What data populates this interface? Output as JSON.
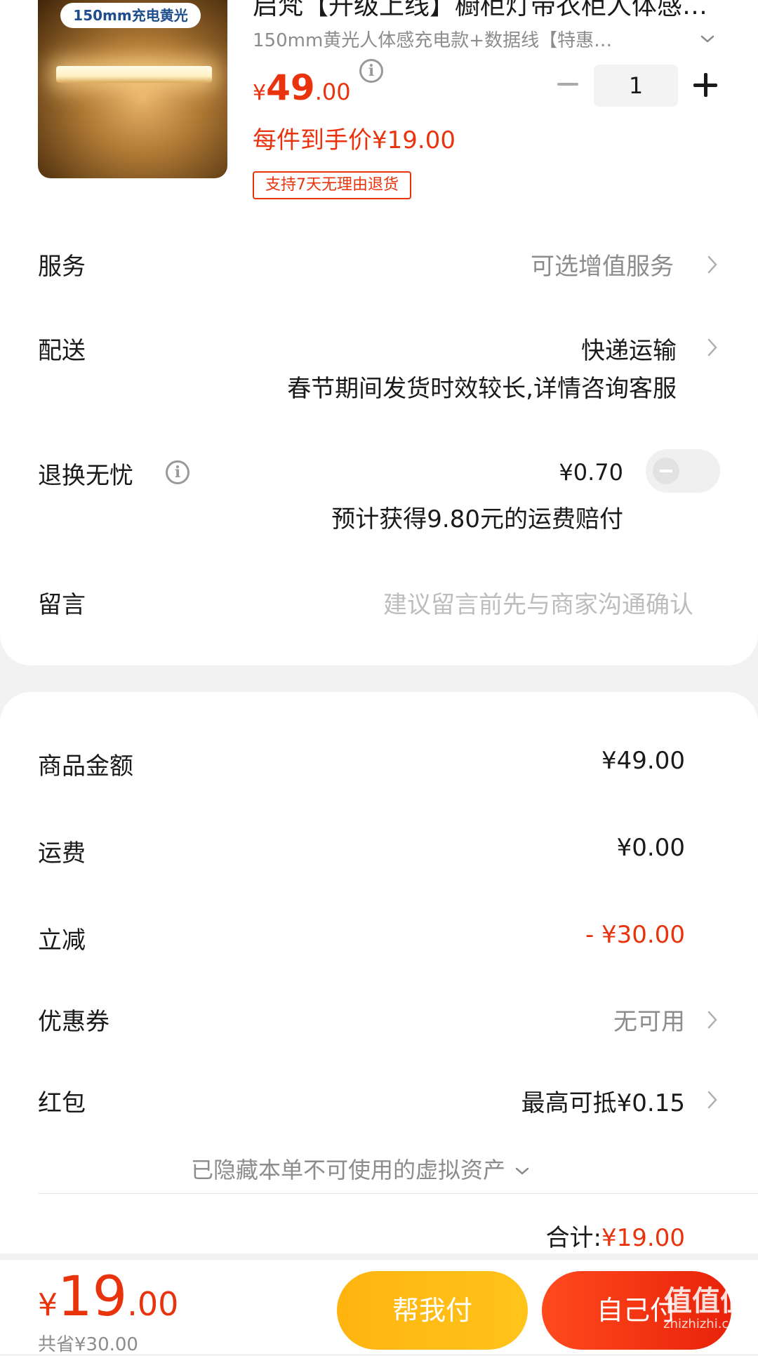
{
  "product": {
    "image_tag": "150mm充电黄光",
    "title": "启梵【升级上线】橱柜灯带衣柜人体感应灯",
    "spec": "150mm黄光人体感充电款+数据线【特惠…",
    "price_currency": "¥",
    "price_integer": "49",
    "price_decimal": ".00",
    "quantity": "1",
    "final_price": "每件到手价¥19.00",
    "return_badge": "支持7天无理由退货"
  },
  "order_options": {
    "service": {
      "label": "服务",
      "value": "可选增值服务"
    },
    "delivery": {
      "label": "配送",
      "value": "快递运输",
      "note": "春节期间发货时效较长,详情咨询客服"
    },
    "return_insurance": {
      "label": "退换无忧",
      "price": "¥0.70",
      "note": "预计获得9.80元的运费赔付",
      "enabled": false
    },
    "message": {
      "label": "留言",
      "placeholder": "建议留言前先与商家沟通确认"
    }
  },
  "summary": {
    "goods_amount": {
      "label": "商品金额",
      "value": "¥49.00"
    },
    "shipping": {
      "label": "运费",
      "value": "¥0.00"
    },
    "discount": {
      "label": "立减",
      "value": "- ¥30.00"
    },
    "coupon": {
      "label": "优惠券",
      "value": "无可用"
    },
    "red_packet": {
      "label": "红包",
      "value": "最高可抵¥0.15"
    },
    "hidden_assets": "已隐藏本单不可使用的虚拟资产",
    "total_label": "合计:",
    "total_value": "¥19.00"
  },
  "bottom_bar": {
    "price_currency": "¥",
    "price_integer": "19",
    "price_decimal": ".00",
    "saved": "共省¥30.00",
    "help_pay_button": "帮我付",
    "self_pay_button": "自己付"
  },
  "watermark": {
    "text": "值值值",
    "url": "zhizhizhi.com"
  },
  "colors": {
    "accent_red": "#e8330c",
    "help_button": "#ffb40f",
    "self_button": "#e8220a"
  }
}
